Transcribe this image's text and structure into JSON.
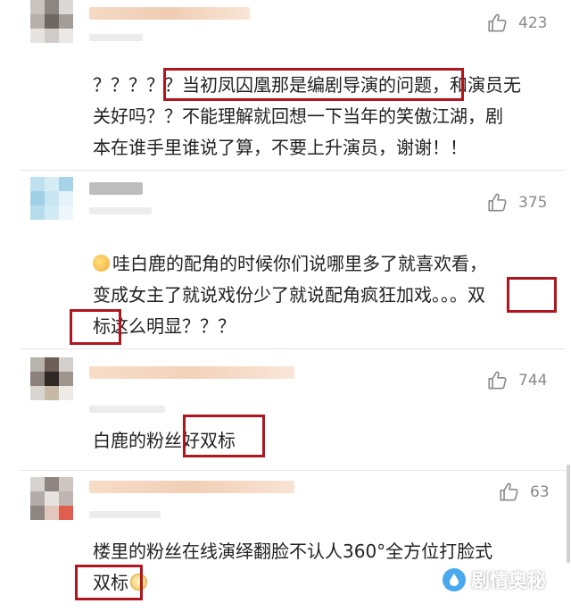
{
  "comments": [
    {
      "likes": "423",
      "lines": [
        "？？？？？当初凤囚凰那是编剧导演的问题，和演员无",
        "关好吗？？不能理解就回想一下当年的笑傲江湖，剧",
        "本在谁手里谁说了算，不要上升演员，谢谢！！"
      ]
    },
    {
      "likes": "375",
      "lines": [
        "哇白鹿的配角的时候你们说哪里多了就喜欢看，",
        "变成女主了就说戏份少了就说配角疯狂加戏。。。双",
        "标这么明显？？？"
      ]
    },
    {
      "likes": "744",
      "lines": [
        "白鹿的粉丝好双标"
      ]
    },
    {
      "likes": "63",
      "lines": [
        "楼里的粉丝在线演绎翻脸不认人360°全方位打脸式",
        "双标"
      ]
    }
  ],
  "watermark": {
    "text": "剧情奥秘",
    "icon": "water-drop-icon"
  },
  "colors": {
    "highlight_box": "#b0161f",
    "text": "#222222",
    "meta": "#8a8a8a"
  }
}
